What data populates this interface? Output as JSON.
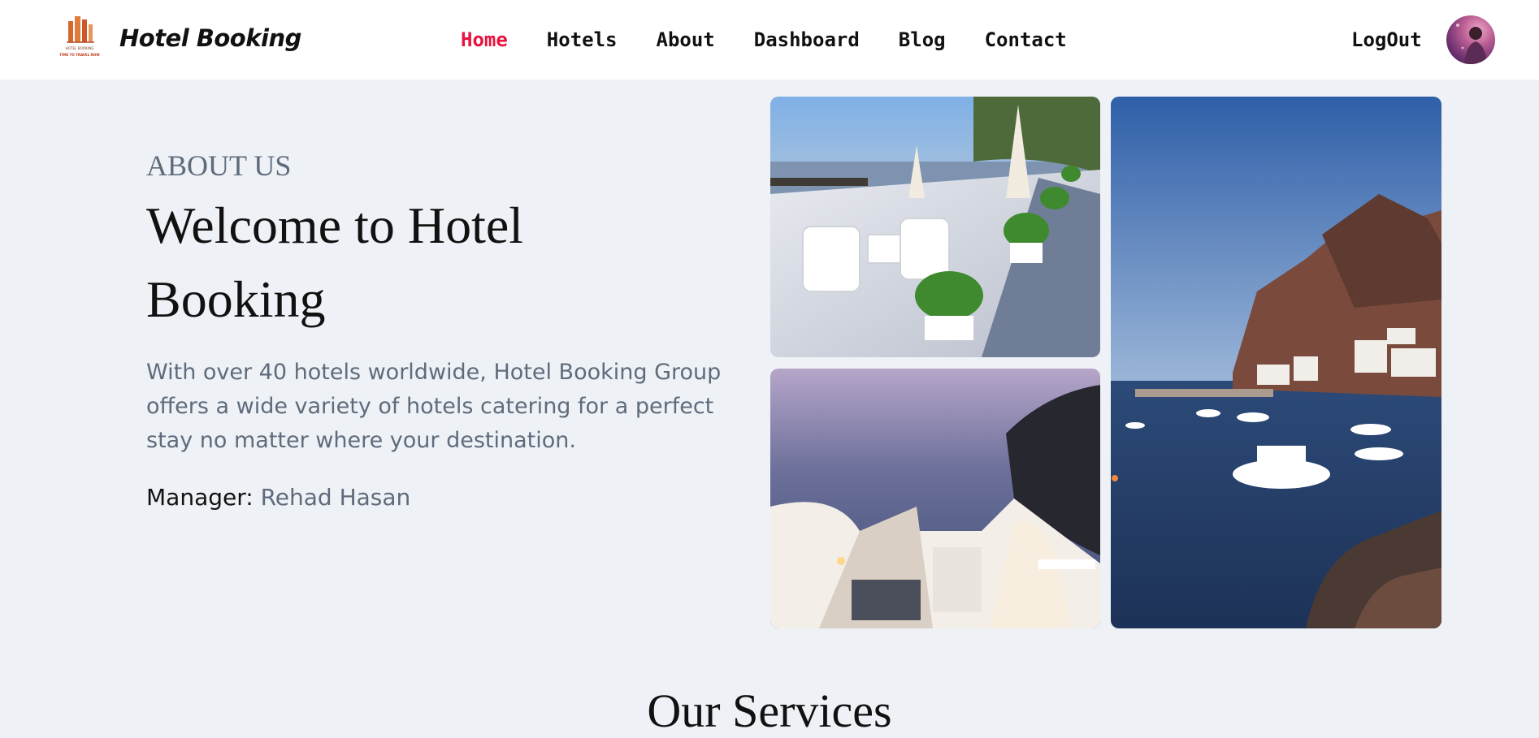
{
  "header": {
    "brand": "Hotel Booking",
    "logo_caption_top": "HOTEL BOOKING",
    "logo_caption_bottom": "TIME TO TRAVEL NOW",
    "nav": [
      {
        "label": "Home",
        "active": true
      },
      {
        "label": "Hotels",
        "active": false
      },
      {
        "label": "About",
        "active": false
      },
      {
        "label": "Dashboard",
        "active": false
      },
      {
        "label": "Blog",
        "active": false
      },
      {
        "label": "Contact",
        "active": false
      }
    ],
    "logout_label": "LogOut",
    "avatar_icon": "user-avatar"
  },
  "about": {
    "kicker": "ABOUT US",
    "title": "Welcome to Hotel Booking",
    "description": "With over 40 hotels worldwide, Hotel Booking Group offers a wide variety of hotels catering for a perfect stay no matter where your destination.",
    "manager_label": "Manager:",
    "manager_name": "Rehad Hasan"
  },
  "gallery": {
    "images": [
      {
        "subject": "seaside terrace with white chairs and umbrellas"
      },
      {
        "subject": "white terrace stairs overlooking the sea"
      },
      {
        "subject": "harbor with boats below cliffs"
      }
    ]
  },
  "services": {
    "title": "Our Services"
  },
  "colors": {
    "accent": "#e8113f",
    "background": "#eef2f6",
    "muted_text": "#5f6b7b"
  }
}
